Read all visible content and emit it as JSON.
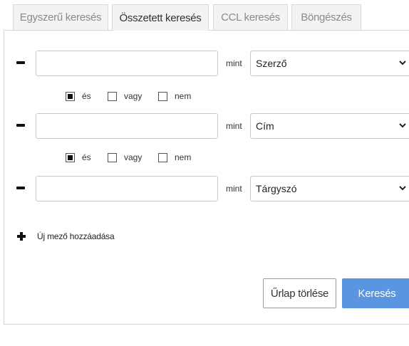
{
  "tabs": [
    {
      "label": "Egyszerű keresés",
      "active": false
    },
    {
      "label": "Összetett keresés",
      "active": true
    },
    {
      "label": "CCL keresés",
      "active": false
    },
    {
      "label": "Böngészés",
      "active": false
    }
  ],
  "fields": [
    {
      "value": "",
      "mint_label": "mint",
      "field_select": "Szerző"
    },
    {
      "value": "",
      "mint_label": "mint",
      "field_select": "Cím"
    },
    {
      "value": "",
      "mint_label": "mint",
      "field_select": "Tárgyszó"
    }
  ],
  "operators": [
    {
      "and": "és",
      "or": "vagy",
      "not": "nem",
      "selected": "és"
    },
    {
      "and": "és",
      "or": "vagy",
      "not": "nem",
      "selected": "és"
    }
  ],
  "add_field_label": "Új mező hozzáadása",
  "buttons": {
    "clear": "Űrlap törlése",
    "search": "Keresés"
  },
  "colors": {
    "accent": "#5a95e2",
    "tab_bg": "#f3f3f3",
    "border": "#d5d5d5"
  }
}
